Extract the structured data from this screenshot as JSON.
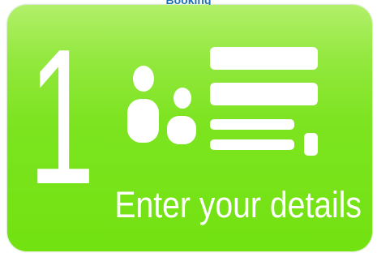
{
  "header": {
    "label": "Booking"
  },
  "step": {
    "number": "1",
    "caption": "Enter your details",
    "icons": [
      "people-icon",
      "list-icon"
    ]
  },
  "colors": {
    "tile_top": "#b2f06a",
    "tile_bottom": "#72e210",
    "text": "#ffffff",
    "label": "#1e6fb5"
  }
}
